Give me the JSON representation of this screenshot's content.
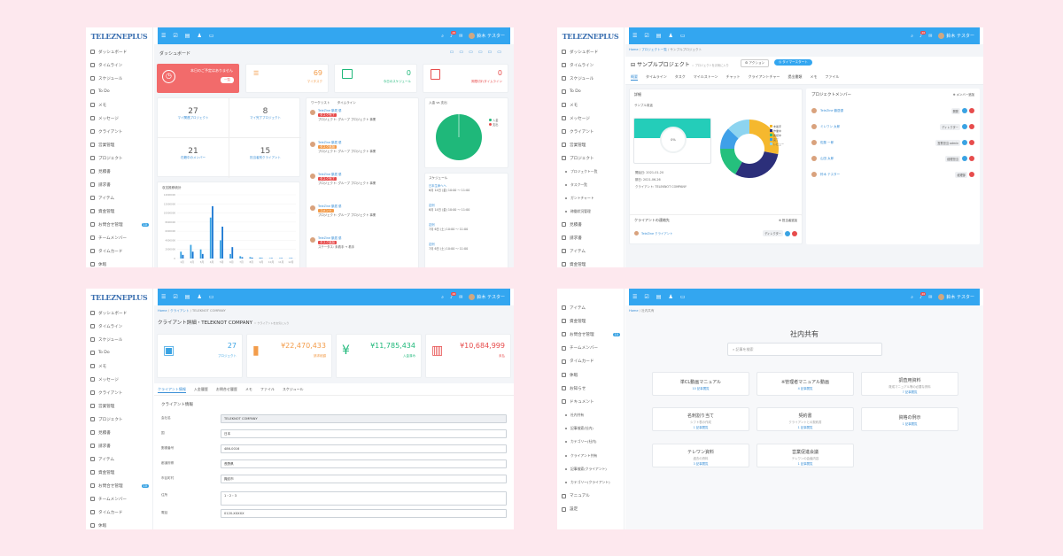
{
  "logo": "TELEZNEPLUS",
  "sidebar_main": [
    {
      "label": "ダッシュボード",
      "icon": "monitor-icon"
    },
    {
      "label": "タイムライン",
      "icon": "timeline-icon"
    },
    {
      "label": "スケジュール",
      "icon": "calendar-icon"
    },
    {
      "label": "To Do",
      "icon": "check-icon"
    },
    {
      "label": "メモ",
      "icon": "memo-icon"
    },
    {
      "label": "メッセージ",
      "icon": "message-icon"
    },
    {
      "label": "クライアント",
      "icon": "client-icon"
    },
    {
      "label": "営業管理",
      "icon": "sales-icon"
    },
    {
      "label": "プロジェクト",
      "icon": "project-icon"
    },
    {
      "label": "見積書",
      "icon": "estimate-icon"
    },
    {
      "label": "請求書",
      "icon": "invoice-icon"
    },
    {
      "label": "アイテム",
      "icon": "item-icon"
    },
    {
      "label": "資金管理",
      "icon": "money-icon"
    },
    {
      "label": "お問合せ管理",
      "icon": "inquiry-icon",
      "badge": "10"
    },
    {
      "label": "チームメンバー",
      "icon": "team-icon"
    },
    {
      "label": "タイムカード",
      "icon": "timecard-icon"
    },
    {
      "label": "休暇",
      "icon": "leave-icon"
    }
  ],
  "sidebar_p2": [
    {
      "label": "ダッシュボード"
    },
    {
      "label": "タイムライン"
    },
    {
      "label": "スケジュール"
    },
    {
      "label": "To Do"
    },
    {
      "label": "メモ"
    },
    {
      "label": "メッセージ"
    },
    {
      "label": "クライアント"
    },
    {
      "label": "営業管理"
    },
    {
      "label": "プロジェクト"
    },
    {
      "label": "プロジェクト一覧",
      "sub": true
    },
    {
      "label": "タスク一覧",
      "sub": true
    },
    {
      "label": "ガントチャート",
      "sub": true
    },
    {
      "label": "稼働状況管理",
      "sub": true
    },
    {
      "label": "見積書"
    },
    {
      "label": "請求書"
    },
    {
      "label": "アイテム"
    },
    {
      "label": "資金管理"
    }
  ],
  "sidebar_p4": [
    {
      "label": "アイテム"
    },
    {
      "label": "資金管理"
    },
    {
      "label": "お問合せ管理",
      "badge": "10"
    },
    {
      "label": "チームメンバー"
    },
    {
      "label": "タイムカード"
    },
    {
      "label": "休暇"
    },
    {
      "label": "お知らせ"
    },
    {
      "label": "ドキュメント"
    },
    {
      "label": "社内共有",
      "sub": true
    },
    {
      "label": "記事検索(社内)",
      "sub": true
    },
    {
      "label": "カテゴリー(社内)",
      "sub": true
    },
    {
      "label": "クライアント共有",
      "sub": true
    },
    {
      "label": "記事検索(クライアント)",
      "sub": true
    },
    {
      "label": "カテゴリー(クライアント)",
      "sub": true
    },
    {
      "label": "マニュアル"
    },
    {
      "label": "設定"
    }
  ],
  "topbar": {
    "user": "鈴木 テスター",
    "notif_count": "26"
  },
  "p1": {
    "title": "ダッシュボード",
    "alert_text": "本日のご予定はありません",
    "alert_btn": "一覧",
    "tasks_count": "69",
    "tasks_label": "マイタスク",
    "events_count": "0",
    "events_label": "今日のスケジュール",
    "late_count": "0",
    "late_label": "期限切れタイムライン",
    "my_projects": "27",
    "my_projects_label": "マイ関連プロジェクト",
    "my_done": "8",
    "my_done_label": "マイ完了プロジェクト",
    "members": "21",
    "members_label": "在籍中のメンバー",
    "clients": "15",
    "clients_label": "担当者別クライアント",
    "chart_title": "収支推移統計",
    "timeline_tabs": [
      "ワークリスト",
      "タイムライン"
    ],
    "timeline": [
      {
        "name": "TeleZine 鶴居 優",
        "tag": "タスク完了",
        "text": "プロジェクト: グループ プロジェクト 事業"
      },
      {
        "name": "TeleZine 鶴居 優",
        "tag": "タスク追加",
        "text": "プロジェクト: グループ プロジェクト 事業"
      },
      {
        "name": "TeleZine 鶴居 優",
        "tag": "タスク完了",
        "text": "プロジェクト: グループ プロジェクト 事業"
      },
      {
        "name": "TeleZine 鶴居 優",
        "tag": "コメント",
        "text": "プロジェクト: グループ プロジェクト 事業"
      },
      {
        "name": "TeleZine 鶴居 優",
        "tag": "タスク追加",
        "text": "ステータス: 未着手 → 着手"
      }
    ],
    "income_title": "入金 vs 支出",
    "legend": [
      "入金",
      "支出"
    ],
    "schedule_title": "スケジュール",
    "schedule": [
      {
        "title": "日本生命ヘヘ",
        "date": "6月 14日 (金) 10:00 ～ 11:00"
      },
      {
        "title": "定例",
        "date": "6月 14日 (金) 10:00 ～ 11:00"
      },
      {
        "title": "定例",
        "date": "7月 6日 (土) 10:00 ～ 11:00"
      },
      {
        "title": "定例",
        "date": "7月 6日 (土) 10:00 ～ 11:00"
      }
    ]
  },
  "p2": {
    "breadcrumb": [
      "Home",
      "プロジェクト一覧",
      "サンプルプロジェクト"
    ],
    "title": "サンプルプロジェクト",
    "fav": "プロジェクトをお気に入り",
    "action_btn": "アクション",
    "timer_btn": "タイマースタート",
    "tabs": [
      "概要",
      "タイムライン",
      "タスク",
      "マイルストーン",
      "チャット",
      "クライアントチャー",
      "提出書類",
      "メモ",
      "ファイル"
    ],
    "detail_title": "詳細",
    "detail_desc": "サンプル用途",
    "progress_label": "0%",
    "start": "開始日: 2021-01-20",
    "end": "期日: 2021-06-26",
    "client_label": "クライアント: TELEKNOT COMPANY",
    "donut_legend": [
      "未着手",
      "作業中",
      "確認中",
      "完了",
      "レビュー"
    ],
    "donut_colors": [
      "#f5b82e",
      "#2c2f7a",
      "#25c07d",
      "#3fa0e8",
      "#8dd4f0"
    ],
    "donut_values": [
      28,
      30,
      17,
      12,
      13
    ],
    "members_title": "プロジェクトメンバー",
    "add_member": "メンバー追加",
    "members": [
      {
        "name": "TeleZine 鶴居優",
        "role": "開発"
      },
      {
        "name": "ミレワン 太郎",
        "role": "ディレクター"
      },
      {
        "name": "佐藤 一郎",
        "role": "営業担当 admin"
      },
      {
        "name": "山田 太郎",
        "role": "経理担当"
      },
      {
        "name": "鈴木 テスター",
        "role": "経理部"
      }
    ],
    "contact_title": "クライアントの連絡先",
    "add_contact": "担当者追加",
    "contact": {
      "name": "TeleZine クライアント",
      "role": "ディレクター"
    }
  },
  "p3": {
    "breadcrumb": [
      "Home",
      "クライアント",
      "TELEKNOT COMPANY"
    ],
    "title": "クライアント詳細・TELEKNOT COMPANY",
    "sub": "クライアントをお気に入り",
    "stats": [
      {
        "value": "27",
        "label": "プロジェクト",
        "color": "#3aa3e3"
      },
      {
        "value": "¥22,470,433",
        "label": "請求総額",
        "color": "#f39c4a"
      },
      {
        "value": "¥11,785,434",
        "label": "入金済み",
        "color": "#1fb87a"
      },
      {
        "value": "¥10,684,999",
        "label": "未払",
        "color": "#e74c4c"
      }
    ],
    "tabs": [
      "クライアント情報",
      "入金履歴",
      "お問合せ履歴",
      "メモ",
      "ファイル",
      "スケジュール"
    ],
    "section": "クライアント情報",
    "fields": [
      {
        "label": "会社名",
        "value": "TELEKNOT COMPANY"
      },
      {
        "label": "国",
        "value": "日本"
      },
      {
        "label": "郵便番号",
        "value": "486-0016"
      },
      {
        "label": "都道府県",
        "value": "長野県"
      },
      {
        "label": "市区町村",
        "value": "諏訪市"
      },
      {
        "label": "住所",
        "value": "1・2・3"
      },
      {
        "label": "電話",
        "value": "0120-XXXXX"
      }
    ]
  },
  "p4": {
    "breadcrumb": [
      "Home",
      "社内共有"
    ],
    "title": "社内共有",
    "search_placeholder": "記事を検索",
    "cards": [
      {
        "title": "単CL動画マニュアル",
        "sub": "",
        "count": "10 記事閲覧"
      },
      {
        "title": "※管理者マニュアル動画",
        "sub": "",
        "count": "4 記事閲覧"
      },
      {
        "title": "調査用資料",
        "sub": "既成マニュアル等の必要な資料",
        "count": "7 記事閲覧"
      },
      {
        "title": "名刺割り当て",
        "sub": "シフト表の作成",
        "count": "1 記事閲覧"
      },
      {
        "title": "契約書",
        "sub": "クライアントとの契約書",
        "count": "1 記事閲覧"
      },
      {
        "title": "資格の例示",
        "sub": "",
        "count": "1 記事閲覧"
      },
      {
        "title": "テレワン資料",
        "sub": "過去の資料",
        "count": "3 記事閲覧"
      },
      {
        "title": "営業促進会議",
        "sub": "テレワンの会議内容",
        "count": "1 記事閲覧"
      }
    ]
  },
  "chart_data": {
    "type": "bar",
    "categories": [
      "1月",
      "2月",
      "3月",
      "4月",
      "5月",
      "6月",
      "7月",
      "8月",
      "9月",
      "10月",
      "11月",
      "12月"
    ],
    "series": [
      {
        "values": [
          1.5,
          3,
          2,
          9,
          4,
          1,
          0.5,
          0.3,
          0.2,
          0.1,
          0.1,
          0.1
        ]
      },
      {
        "values": [
          0.8,
          1.5,
          1,
          11.5,
          7,
          2.5,
          0.3,
          0.2,
          0.1,
          0.1,
          0.1,
          0.1
        ]
      }
    ],
    "ylim": [
      0,
      14
    ],
    "yticks": [
      "14000000",
      "12000000",
      "10000000",
      "8000000",
      "6000000",
      "4000000",
      "2000000",
      "0"
    ]
  }
}
